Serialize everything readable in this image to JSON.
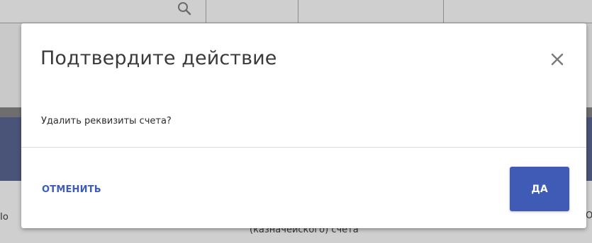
{
  "background": {
    "search_icon": "search-icon",
    "left_fragment": "Іо",
    "bottom_fragment": "(казначейского) счета",
    "right_fragment": "О"
  },
  "dialog": {
    "title": "Подтвердите действие",
    "close_icon": "close-icon",
    "message": "Удалить реквизиты счета?",
    "cancel_label": "ОТМЕНИТЬ",
    "confirm_label": "ДА"
  },
  "colors": {
    "accent": "#3f5bb5",
    "cancel_text": "#3d5cb8",
    "overlay_band": "#4a5478"
  }
}
